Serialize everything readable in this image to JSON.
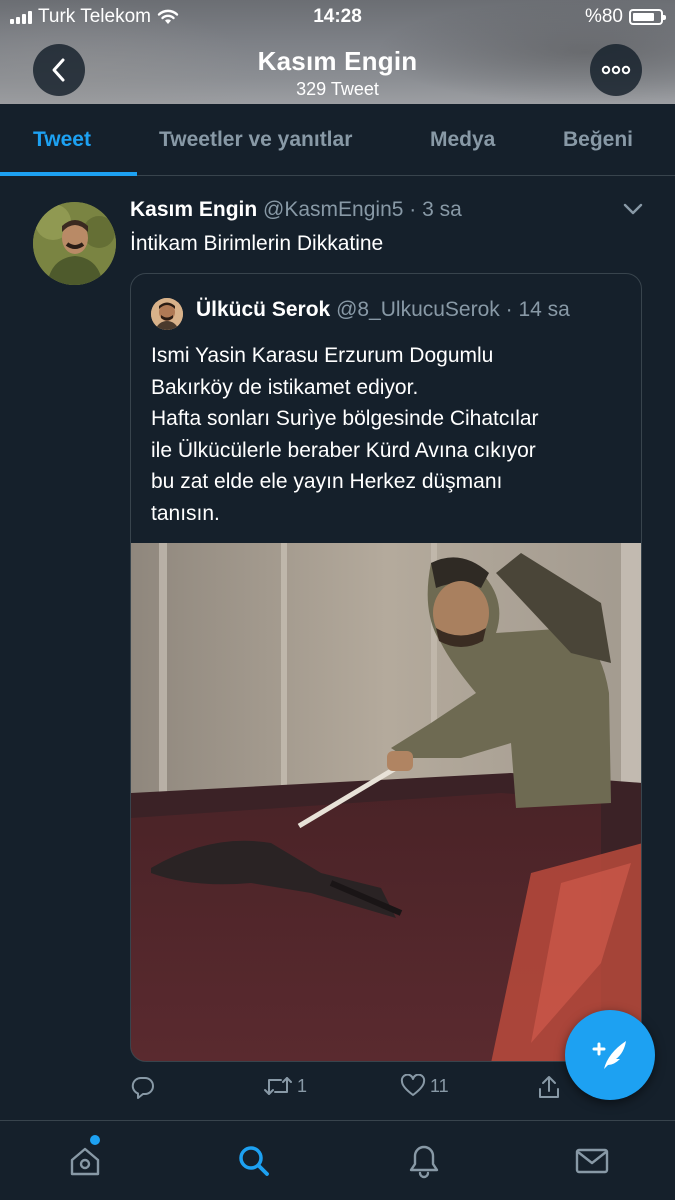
{
  "status_bar": {
    "carrier": "Turk Telekom",
    "time": "14:28",
    "battery": "%80",
    "battery_level": 0.8
  },
  "profile": {
    "name": "Kasım Engin",
    "tweet_count": "329 Tweet"
  },
  "tabs": [
    {
      "label": "Tweet",
      "active": true
    },
    {
      "label": "Tweetler ve yanıtlar",
      "active": false
    },
    {
      "label": "Medya",
      "active": false
    },
    {
      "label": "Beğeni",
      "active": false
    }
  ],
  "tweet": {
    "name": "Kasım Engin",
    "handle": "@KasmEngin5",
    "time": "· 3 sa",
    "text": "İntikam Birimlerin Dikkatine",
    "quoted": {
      "name": "Ülkücü Serok",
      "handle": "@8_UlkucuSerok",
      "time": "· 14 sa",
      "text": "Ismi Yasin Karasu Erzurum Dogumlu\nBakırköy de istikamet ediyor.\nHafta sonları Surìye bölgesinde Cihatcılar\nile Ülkücülerle beraber Kürd Avına cıkıyor\nbu zat elde ele yayın Herkez düşmanı\ntanısın."
    },
    "actions": {
      "reply_count": "",
      "retweet_count": "1",
      "like_count": "11"
    }
  },
  "icons": {
    "back": "back-icon",
    "more": "more-icon",
    "caret": "chevron-down-icon",
    "reply": "reply-icon",
    "retweet": "retweet-icon",
    "like": "heart-icon",
    "share": "share-icon",
    "compose": "compose-icon",
    "home": "home-icon",
    "search": "search-icon",
    "notifications": "bell-icon",
    "messages": "mail-icon"
  },
  "colors": {
    "background": "#15202b",
    "accent": "#1da1f2",
    "secondary_text": "#8899a6",
    "border": "#38444d"
  }
}
